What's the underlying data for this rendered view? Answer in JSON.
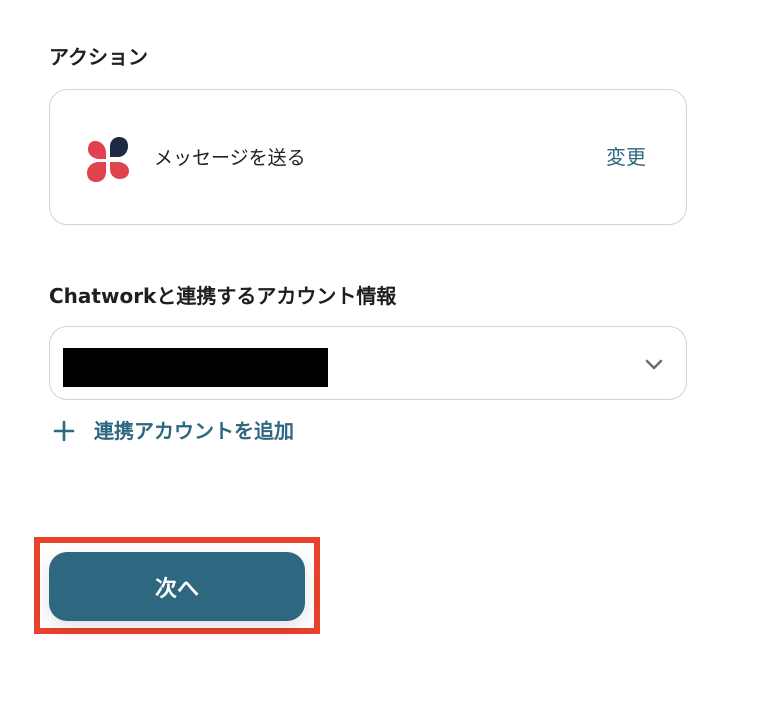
{
  "action": {
    "section_label": "アクション",
    "name": "メッセージを送る",
    "change_label": "変更",
    "app_icon": "chatwork-logo-icon"
  },
  "account": {
    "section_label": "Chatworkと連携するアカウント情報",
    "selected_value_redacted": true,
    "dropdown_icon": "chevron-down-icon",
    "add_label": "連携アカウントを追加",
    "add_icon": "plus-icon"
  },
  "footer": {
    "next_label": "次へ",
    "highlight": true
  },
  "colors": {
    "accent": "#2e6780",
    "border": "#cfd3d7",
    "highlight": "#e8412c",
    "logo_red": "#e0424e",
    "logo_navy": "#1d2a44"
  }
}
